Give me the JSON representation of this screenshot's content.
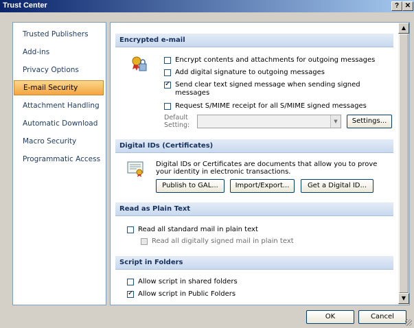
{
  "window": {
    "title": "Trust Center",
    "help_label": "?",
    "close_label": "✕"
  },
  "nav": {
    "items": [
      {
        "label": "Trusted Publishers"
      },
      {
        "label": "Add-ins"
      },
      {
        "label": "Privacy Options"
      },
      {
        "label": "E-mail Security"
      },
      {
        "label": "Attachment Handling"
      },
      {
        "label": "Automatic Download"
      },
      {
        "label": "Macro Security"
      },
      {
        "label": "Programmatic Access"
      }
    ],
    "active_index": 3
  },
  "sections": {
    "encrypted": {
      "title": "Encrypted e-mail",
      "options": [
        {
          "label": "Encrypt contents and attachments for outgoing messages",
          "checked": false
        },
        {
          "label": "Add digital signature to outgoing messages",
          "checked": false
        },
        {
          "label": "Send clear text signed message when sending signed",
          "label2": "messages",
          "checked": true
        },
        {
          "label": "Request S/MIME receipt for all S/MIME signed messages",
          "checked": false
        }
      ],
      "default_setting_label_1": "Default",
      "default_setting_label_2": "Setting:",
      "default_setting_value": "",
      "settings_button": "Settings..."
    },
    "digital_ids": {
      "title": "Digital IDs (Certificates)",
      "description_1": "Digital IDs or Certificates are documents that allow you to prove",
      "description_2": "your identity in electronic transactions.",
      "buttons": [
        "Publish to GAL...",
        "Import/Export...",
        "Get a Digital ID..."
      ]
    },
    "plain_text": {
      "title": "Read as Plain Text",
      "option1": {
        "label": "Read all standard mail in plain text",
        "checked": false
      },
      "option2": {
        "label": "Read all digitally signed mail in plain text",
        "checked": false,
        "disabled": true
      }
    },
    "script": {
      "title": "Script in Folders",
      "option1": {
        "label": "Allow script in shared folders",
        "checked": false
      },
      "option2": {
        "label": "Allow script in Public Folders",
        "checked": true
      }
    }
  },
  "footer": {
    "ok": "OK",
    "cancel": "Cancel"
  },
  "colors": {
    "title_start": "#0a246a",
    "title_end": "#a6caf0",
    "active_nav": "#f5a441",
    "section_head": "#c9d9ef"
  }
}
